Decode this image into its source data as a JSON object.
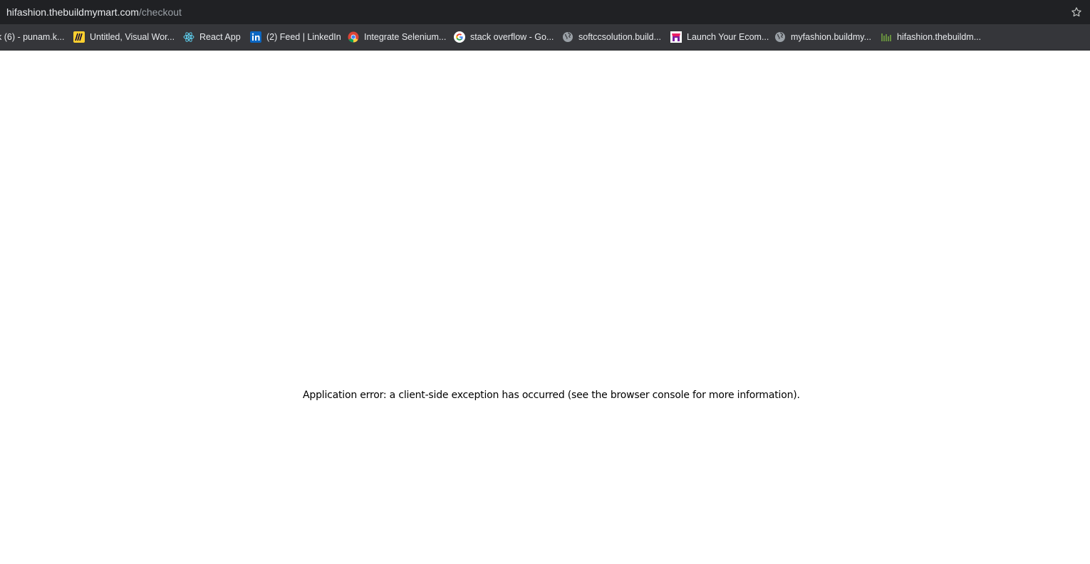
{
  "address_bar": {
    "host": "hifashion.thebuildmymart.com",
    "path": "/checkout"
  },
  "bookmarks": [
    {
      "label": "k (6) - punam.k...",
      "icon": "blank-icon"
    },
    {
      "label": "Untitled, Visual Wor...",
      "icon": "miro-icon",
      "color": "#ffd02f"
    },
    {
      "label": "React App",
      "icon": "react-icon",
      "color": "#61dafb"
    },
    {
      "label": "(2) Feed | LinkedIn",
      "icon": "linkedin-icon",
      "color": "#0a66c2"
    },
    {
      "label": "Integrate Selenium...",
      "icon": "chrome-icon"
    },
    {
      "label": "stack overflow - Go...",
      "icon": "google-icon"
    },
    {
      "label": "softccsolution.build...",
      "icon": "globe-icon"
    },
    {
      "label": "Launch Your Ecom...",
      "icon": "store-icon"
    },
    {
      "label": "myfashion.buildmy...",
      "icon": "globe-icon"
    },
    {
      "label": "hifashion.thebuildm...",
      "icon": "leaf-icon",
      "color": "#7cb342"
    }
  ],
  "page": {
    "error_message": "Application error: a client-side exception has occurred (see the browser console for more information)."
  }
}
